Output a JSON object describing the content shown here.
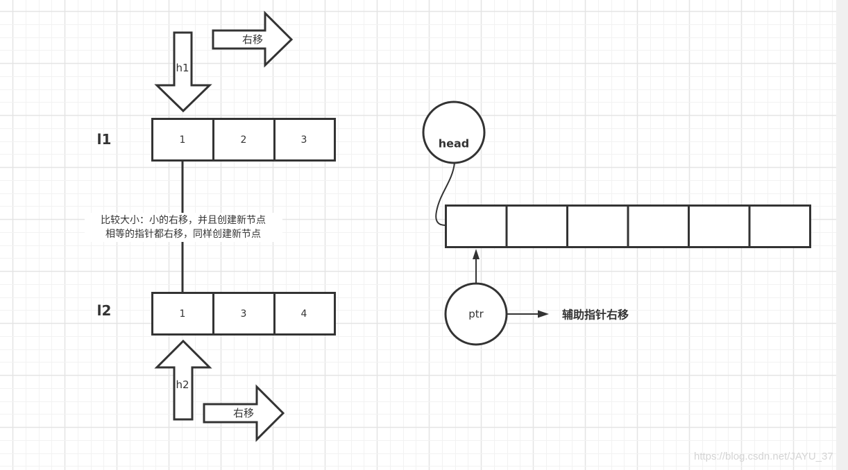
{
  "diagram": {
    "list1": {
      "label": "l1",
      "cells": [
        "1",
        "2",
        "3"
      ],
      "pointer_label": "h1",
      "move_label": "右移"
    },
    "list2": {
      "label": "l2",
      "cells": [
        "1",
        "3",
        "4"
      ],
      "pointer_label": "h2",
      "move_label": "右移"
    },
    "note": {
      "line1": "比较大小：小的右移，并且创建新节点",
      "line2": "相等的指针都右移，同样创建新节点"
    },
    "result": {
      "head_label": "head",
      "ptr_label": "ptr",
      "cell_count": 6,
      "cells": [
        "",
        "",
        "",
        "",
        "",
        ""
      ],
      "ptr_move_label": "辅助指针右移"
    },
    "watermark": "https://blog.csdn.net/JAYU_37"
  },
  "colors": {
    "stroke": "#333333",
    "grid_minor": "#f2f2f2",
    "grid_major": "#e4e4e4"
  }
}
